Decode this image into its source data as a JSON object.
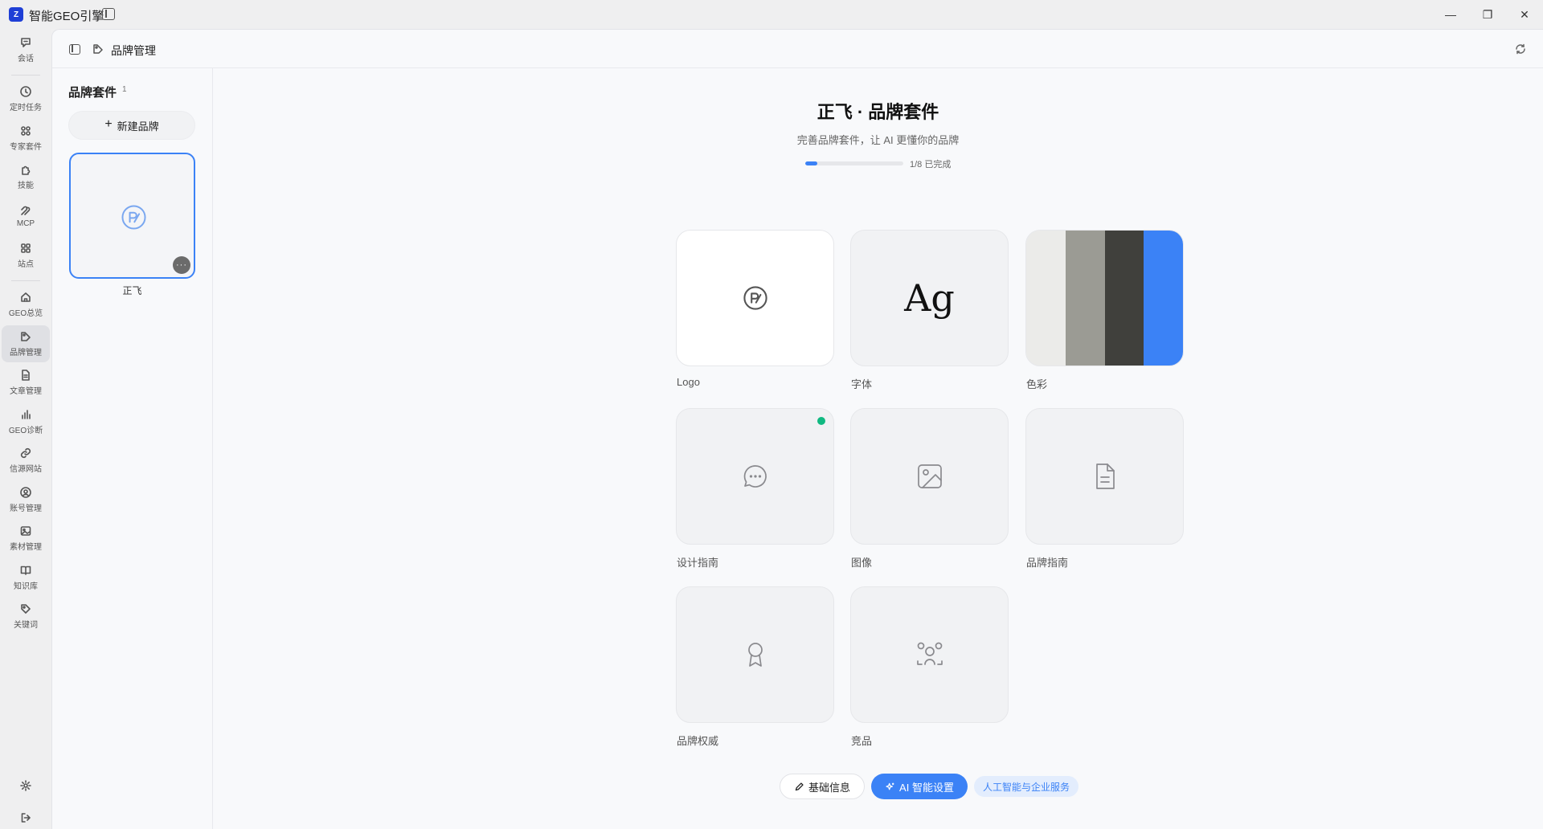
{
  "app": {
    "title": "智能GEO引擎",
    "logo_text": "Z",
    "window_controls": {
      "minimize": "—",
      "restore": "❐",
      "close": "✕"
    }
  },
  "rail": {
    "items": [
      {
        "label": "会话",
        "icon": "chat-icon"
      },
      {
        "label": "定时任务",
        "icon": "clock-icon"
      },
      {
        "label": "专家套件",
        "icon": "grid-icon"
      },
      {
        "label": "技能",
        "icon": "puzzle-icon"
      },
      {
        "label": "MCP",
        "icon": "mcp-icon"
      },
      {
        "label": "站点",
        "icon": "sites-icon"
      },
      {
        "label": "GEO总览",
        "icon": "home-icon"
      },
      {
        "label": "品牌管理",
        "icon": "brand-icon",
        "active": true
      },
      {
        "label": "文章管理",
        "icon": "document-icon"
      },
      {
        "label": "GEO诊断",
        "icon": "bar-chart-icon"
      },
      {
        "label": "信源网站",
        "icon": "link-icon"
      },
      {
        "label": "账号管理",
        "icon": "user-circle-icon"
      },
      {
        "label": "素材管理",
        "icon": "image-icon"
      },
      {
        "label": "知识库",
        "icon": "book-icon"
      },
      {
        "label": "关键词",
        "icon": "tag-icon"
      }
    ],
    "bottom": [
      {
        "icon": "settings-icon"
      },
      {
        "icon": "logout-icon"
      }
    ]
  },
  "header": {
    "breadcrumb": "品牌管理"
  },
  "brand_panel": {
    "title": "品牌套件",
    "count": "1",
    "new_button": "新建品牌",
    "brands": [
      {
        "name": "正飞",
        "more": "···"
      }
    ]
  },
  "kit": {
    "title": "正飞 · 品牌套件",
    "subtitle": "完善品牌套件，让 AI 更懂你的品牌",
    "progress": 0.125,
    "progress_text": "1/8 已完成",
    "tiles": [
      {
        "key": "logo",
        "label": "Logo",
        "icon": "brand-logo-icon"
      },
      {
        "key": "font",
        "label": "字体",
        "preview": "Ag"
      },
      {
        "key": "color",
        "label": "色彩",
        "swatches": [
          "#ebebe9",
          "#9b9b94",
          "#40403c",
          "#3b82f6"
        ]
      },
      {
        "key": "design",
        "label": "设计指南",
        "icon": "chat-dots-icon",
        "complete": true
      },
      {
        "key": "image",
        "label": "图像",
        "icon": "image-icon"
      },
      {
        "key": "guide",
        "label": "品牌指南",
        "icon": "document-icon"
      },
      {
        "key": "authority",
        "label": "品牌权威",
        "icon": "award-icon"
      },
      {
        "key": "competitor",
        "label": "竞品",
        "icon": "competitors-icon"
      }
    ]
  },
  "actions": {
    "basic_info": "基础信息",
    "ai_setup": "AI 智能设置",
    "industry_tag": "人工智能与企业服务"
  },
  "colors": {
    "accent": "#3b82f6",
    "complete": "#10b981"
  }
}
